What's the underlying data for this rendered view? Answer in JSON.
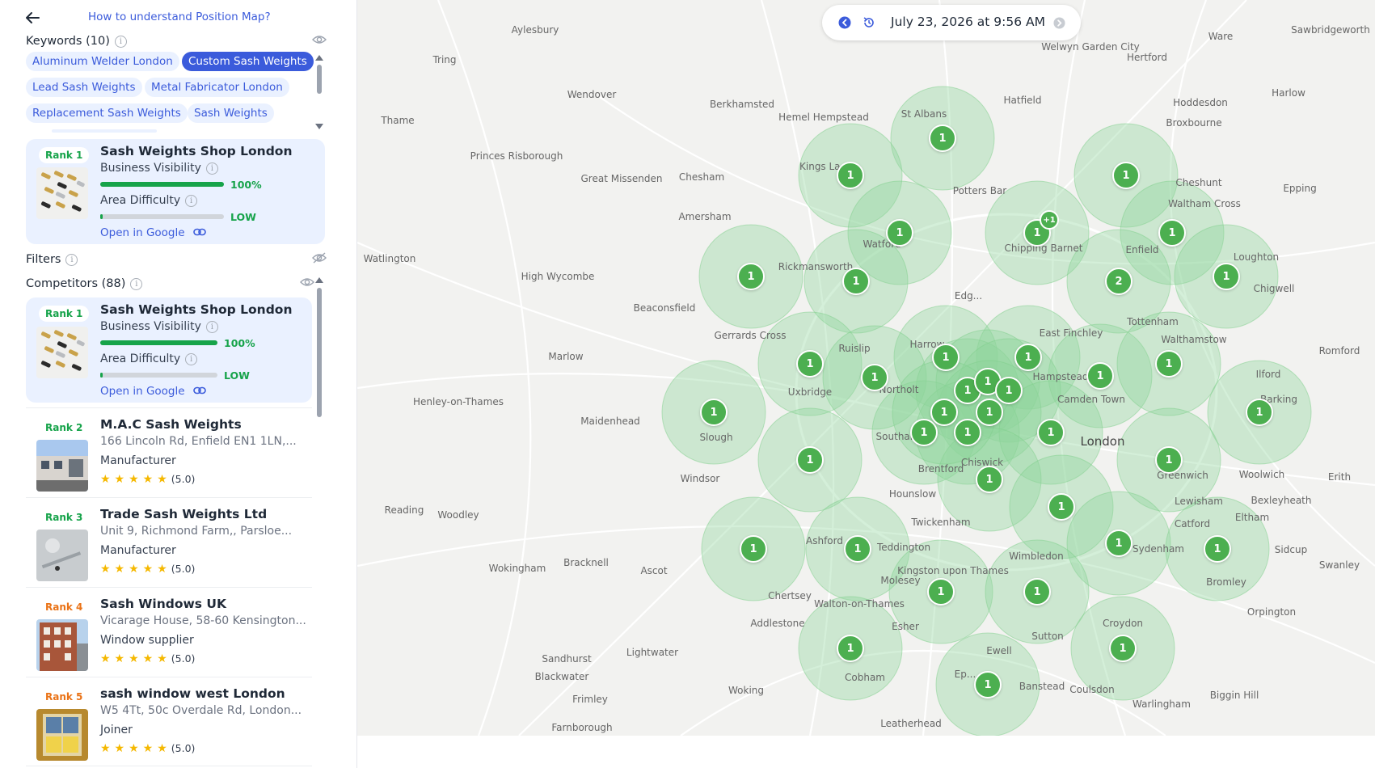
{
  "sidebar": {
    "help_link": "How to understand Position Map?",
    "keywords_label": "Keywords (10)",
    "keywords": [
      {
        "label": "Aluminum Welder London",
        "active": false
      },
      {
        "label": "Custom Sash Weights",
        "active": true
      },
      {
        "label": "Lead Sash Weights",
        "active": false
      },
      {
        "label": "Metal Fabricator London",
        "active": false
      },
      {
        "label": "Replacement Sash Weights",
        "active": false
      },
      {
        "label": "Sash Weights",
        "active": false
      }
    ],
    "my_business": {
      "rank": "Rank 1",
      "name": "Sash Weights Shop London",
      "visibility_label": "Business Visibility",
      "visibility_value": "100%",
      "visibility_fraction": 1.0,
      "difficulty_label": "Area Difficulty",
      "difficulty_value": "LOW",
      "difficulty_fraction": 0.02,
      "google_link": "Open in Google"
    },
    "filters_label": "Filters",
    "competitors_label": "Competitors (88)",
    "competitors": [
      {
        "rank": "Rank 1",
        "name": "Sash Weights Shop London",
        "visibility_label": "Business Visibility",
        "visibility_value": "100%",
        "difficulty_label": "Area Difficulty",
        "difficulty_value": "LOW",
        "google_link": "Open in Google"
      },
      {
        "rank": "Rank 2",
        "name": "M.A.C Sash Weights",
        "address": "166 Lincoln Rd, Enfield EN1 1LN,...",
        "category": "Manufacturer",
        "rating": "(5.0)"
      },
      {
        "rank": "Rank 3",
        "name": "Trade Sash Weights Ltd",
        "address": "Unit 9, Richmond Farm,, Parsloe...",
        "category": "Manufacturer",
        "rating": "(5.0)"
      },
      {
        "rank": "Rank 4",
        "name": "Sash Windows UK",
        "address": "Vicarage House, 58-60 Kensington...",
        "category": "Window supplier",
        "rating": "(5.0)"
      },
      {
        "rank": "Rank 5",
        "name": "sash window west London",
        "address": "W5 4Tt, 50c Overdale Rd, London...",
        "category": "Joiner",
        "rating": "(5.0)"
      }
    ]
  },
  "map": {
    "date_label": "July 23, 2026 at 9:56 AM",
    "pin_color": "#4caf50",
    "circle_color": "#8fd49a",
    "pins": [
      {
        "label": "1"
      },
      {
        "label": "1"
      },
      {
        "label": "1"
      },
      {
        "label": "1"
      },
      {
        "label": "1"
      },
      {
        "label": "1"
      },
      {
        "label": "1"
      },
      {
        "label": "1"
      },
      {
        "label": "2"
      },
      {
        "label": "1"
      },
      {
        "label": "1"
      },
      {
        "label": "1"
      },
      {
        "label": "1"
      },
      {
        "label": "1"
      },
      {
        "label": "1"
      },
      {
        "label": "1"
      },
      {
        "label": "1"
      },
      {
        "label": "1"
      },
      {
        "label": "1"
      },
      {
        "label": "1"
      },
      {
        "label": "1"
      },
      {
        "label": "1"
      },
      {
        "label": "1"
      },
      {
        "label": "1"
      },
      {
        "label": "1"
      },
      {
        "label": "1"
      },
      {
        "label": "1"
      },
      {
        "label": "1"
      },
      {
        "label": "1"
      },
      {
        "label": "1"
      },
      {
        "label": "1"
      },
      {
        "label": "1"
      },
      {
        "label": "1"
      },
      {
        "label": "1"
      },
      {
        "label": "1"
      },
      {
        "label": "1"
      },
      {
        "label": "1"
      },
      {
        "label": "1"
      },
      {
        "label": "1"
      }
    ],
    "extra_badge": "+1",
    "places": [
      "Aylesbury",
      "Tring",
      "Wendover",
      "Berkhamsted",
      "Hemel Hempstead",
      "St Albans",
      "Hatfield",
      "Welwyn Garden City",
      "Ware",
      "Hertford",
      "Sawbridgeworth",
      "Harlow",
      "Hoddesdon",
      "Broxbourne",
      "Cheshunt",
      "Waltham Cross",
      "Epping",
      "Thame",
      "Princes Risborough",
      "Great Missenden",
      "Chesham",
      "Kings La...",
      "Potters Bar",
      "Amersham",
      "Watford",
      "Chipping Barnet",
      "Enfield",
      "Loughton",
      "Chigwell",
      "Watlington",
      "High Wycombe",
      "Rickmansworth",
      "Beaconsfield",
      "Edg...",
      "Tottenham",
      "Walthamstow",
      "Gerrards Cross",
      "East Finchley",
      "Harrow",
      "Ruislip",
      "Romford",
      "Marlow",
      "Hampstead",
      "Ilford",
      "Uxbridge",
      "Northolt",
      "Camden Town",
      "Henley-on-Thames",
      "Maidenhead",
      "Slough",
      "Southall",
      "London",
      "Barking",
      "Brentford",
      "Chiswick",
      "Greenwich",
      "Woolwich",
      "Erith",
      "Windsor",
      "Hounslow",
      "Twickenham",
      "Lewisham",
      "Bexleyheath",
      "Reading",
      "Woodley",
      "Catford",
      "Eltham",
      "Ashford",
      "Teddington",
      "Sydenham",
      "Sidcup",
      "Bracknell",
      "Wokingham",
      "Ascot",
      "Kingston upon Thames",
      "Wimbledon",
      "Bromley",
      "Swanley",
      "Chertsey",
      "Molesey",
      "Walton-on-Thames",
      "Addlestone",
      "Esher",
      "Croydon",
      "Orpington",
      "Lightwater",
      "Sutton",
      "Sandhurst",
      "Blackwater",
      "Cobham",
      "Ewell",
      "Woking",
      "Frimley",
      "Banstead",
      "Coulsdon",
      "Warlingham",
      "Biggin Hill",
      "Farnborough",
      "Leatherhead",
      "Ep..."
    ]
  }
}
